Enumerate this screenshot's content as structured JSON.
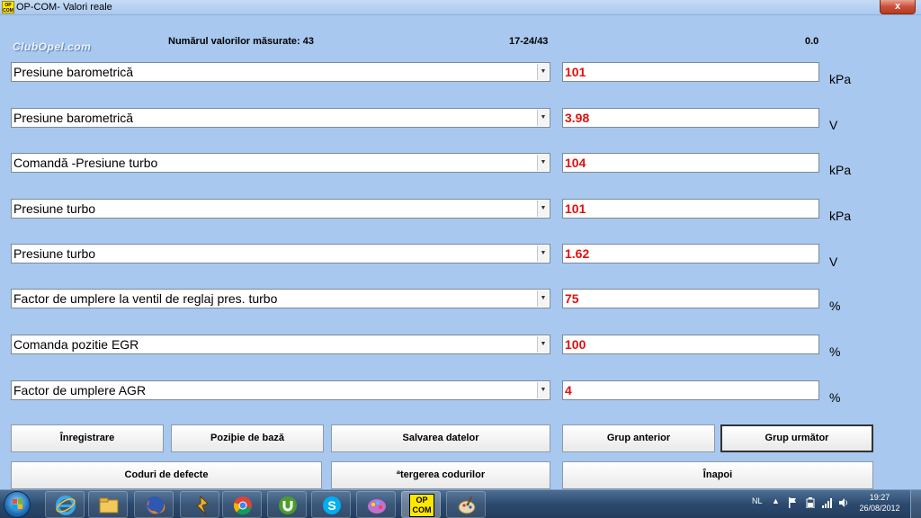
{
  "window": {
    "title": "OP-COM- Valori reale",
    "close_label": "x",
    "app_icon_text": "OP COM"
  },
  "header": {
    "logo": "ClubOpel.com",
    "measured_count_label": "Numărul valorilor măsurate: 43",
    "range": "17-24/43",
    "time_value": "0.0"
  },
  "rows": [
    {
      "name": "Presiune barometrică",
      "value": "101",
      "unit": "kPa"
    },
    {
      "name": "Presiune barometrică",
      "value": "3.98",
      "unit": "V"
    },
    {
      "name": "Comandă -Presiune turbo",
      "value": "104",
      "unit": "kPa"
    },
    {
      "name": "Presiune turbo",
      "value": "101",
      "unit": "kPa"
    },
    {
      "name": "Presiune turbo",
      "value": "1.62",
      "unit": "V"
    },
    {
      "name": "Factor de umplere la ventil  de reglaj pres. turbo",
      "value": "75",
      "unit": "%"
    },
    {
      "name": "Comanda pozitie EGR",
      "value": "100",
      "unit": "%"
    },
    {
      "name": "Factor de umplere AGR",
      "value": "4",
      "unit": "%"
    }
  ],
  "buttons": {
    "record": "Înregistrare",
    "base_position": "Poziþie de bază",
    "save_data": "Salvarea datelor",
    "prev_group": "Grup anterior",
    "next_group": "Grup următor",
    "fault_codes": "Coduri de defecte",
    "clear_codes": "ªtergerea codurilor",
    "back": "Înapoi"
  },
  "taskbar": {
    "opcom_label": "OP COM",
    "language": "NL",
    "time": "19:27",
    "date": "26/08/2012",
    "icons": [
      "start-orb",
      "internet-explorer-icon",
      "file-explorer-icon",
      "firefox-icon",
      "winamp-icon",
      "chrome-icon",
      "utorrent-icon",
      "skype-icon",
      "paint-app-icon",
      "opcom-icon",
      "paint-palette-icon"
    ]
  },
  "colors": {
    "background": "#a8c8ef",
    "value_text": "#e01010"
  }
}
